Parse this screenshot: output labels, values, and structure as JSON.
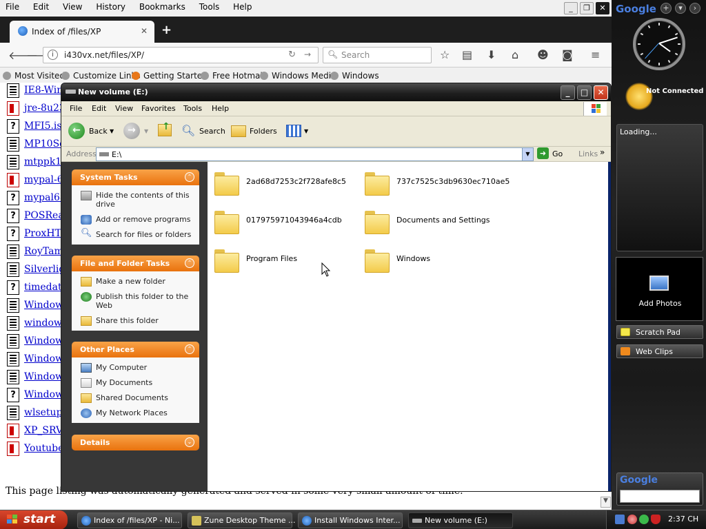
{
  "firefox": {
    "menu": [
      "File",
      "Edit",
      "View",
      "History",
      "Bookmarks",
      "Tools",
      "Help"
    ],
    "tab_title": "Index of /files/XP",
    "url": "i430vx.net/files/XP/",
    "search_placeholder": "Search",
    "bookmarks": [
      "Most Visited",
      "Customize Links",
      "Getting Started",
      "Free Hotmail",
      "Windows Media",
      "Windows"
    ],
    "files": [
      {
        "name": "IE8-Win",
        "icon": "binary-file-icon"
      },
      {
        "name": "jre-8u23",
        "icon": "java-file-icon"
      },
      {
        "name": "MFI5.iso",
        "icon": "unknown-file-icon"
      },
      {
        "name": "MP10Se",
        "icon": "binary-file-icon"
      },
      {
        "name": "mtppk12",
        "icon": "binary-file-icon"
      },
      {
        "name": "mypal-68",
        "icon": "java-file-icon"
      },
      {
        "name": "mypal68",
        "icon": "unknown-file-icon"
      },
      {
        "name": "POSRea",
        "icon": "unknown-file-icon"
      },
      {
        "name": "ProxHT",
        "icon": "unknown-file-icon"
      },
      {
        "name": "RoyTam",
        "icon": "binary-file-icon"
      },
      {
        "name": "Silverligh",
        "icon": "binary-file-icon"
      },
      {
        "name": "timedate",
        "icon": "unknown-file-icon"
      },
      {
        "name": "Window",
        "icon": "binary-file-icon"
      },
      {
        "name": "windows",
        "icon": "binary-file-icon"
      },
      {
        "name": "Window",
        "icon": "binary-file-icon"
      },
      {
        "name": "Window",
        "icon": "binary-file-icon"
      },
      {
        "name": "Window",
        "icon": "binary-file-icon"
      },
      {
        "name": "Window",
        "icon": "unknown-file-icon"
      },
      {
        "name": "wlsetup-",
        "icon": "binary-file-icon"
      },
      {
        "name": "XP_SRV",
        "icon": "java-file-icon"
      },
      {
        "name": "Youtube",
        "icon": "java-file-icon"
      }
    ],
    "footer": "This page listing was automatically generated and served in some very small amount of time."
  },
  "explorer": {
    "title": "New volume (E:)",
    "menu": [
      "File",
      "Edit",
      "View",
      "Favorites",
      "Tools",
      "Help"
    ],
    "toolbar": {
      "back": "Back",
      "search": "Search",
      "folders": "Folders"
    },
    "address_label": "Address",
    "address_value": "E:\\",
    "go_label": "Go",
    "links_label": "Links",
    "panels": [
      {
        "title": "System Tasks",
        "tasks": [
          "Hide the contents of this drive",
          "Add or remove programs",
          "Search for files or folders"
        ]
      },
      {
        "title": "File and Folder Tasks",
        "tasks": [
          "Make a new folder",
          "Publish this folder to the Web",
          "Share this folder"
        ]
      },
      {
        "title": "Other Places",
        "tasks": [
          "My Computer",
          "My Documents",
          "Shared Documents",
          "My Network Places"
        ]
      },
      {
        "title": "Details",
        "tasks": []
      }
    ],
    "folders": [
      "2ad68d7253c2f728afe8c5",
      "737c7525c3db9630ec710ae5",
      "017975971043946a4cdb",
      "Documents and Settings",
      "Program Files",
      "Windows"
    ]
  },
  "sidebar": {
    "logo": "Google",
    "clock": {
      "hour": 4,
      "minute": 12,
      "second": 37
    },
    "weather_status": "Not Connected",
    "news_status": "Loading...",
    "photos_label": "Add Photos",
    "links": [
      "Scratch Pad",
      "Web Clips"
    ],
    "search_logo": "Google"
  },
  "taskbar": {
    "start": "start",
    "tasks": [
      "Index of /files/XP - Ni...",
      "Zune Desktop Theme ...",
      "Install Windows Inter...",
      "New volume (E:)"
    ],
    "time": "2:37",
    "lang": "CH"
  },
  "colors": {
    "xp_panel_header": "#e9720d",
    "xp_title": "#1f1f1f",
    "link": "#0000cc",
    "sidebar_bg": "#1a1a1a"
  }
}
